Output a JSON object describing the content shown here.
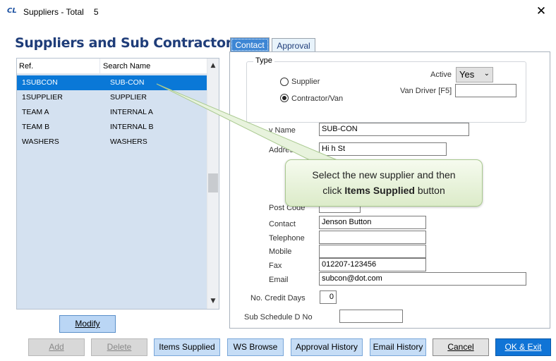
{
  "window": {
    "icon_text": "CL",
    "title": "Suppliers - Total",
    "total": "5",
    "close": "✕"
  },
  "heading": "Suppliers and Sub Contractors",
  "list": {
    "columns": [
      "Ref.",
      "Search Name"
    ],
    "rows": [
      {
        "ref": "1SUBCON",
        "name": "SUB-CON",
        "selected": true
      },
      {
        "ref": "1SUPPLIER",
        "name": "SUPPLIER",
        "selected": false
      },
      {
        "ref": "TEAM A",
        "name": "INTERNAL A",
        "selected": false
      },
      {
        "ref": "TEAM B",
        "name": "INTERNAL B",
        "selected": false
      },
      {
        "ref": "WASHERS",
        "name": "WASHERS",
        "selected": false
      }
    ],
    "scroll_up": "▲",
    "scroll_down": "▼"
  },
  "tabs": {
    "contact": "Contact",
    "approval": "Approval"
  },
  "form": {
    "type_legend": "Type",
    "supplier_label": "Supplier",
    "contractor_label": "Contractor/Van",
    "selected_type": "Contractor/Van",
    "active_label": "Active",
    "active_value": "Yes",
    "active_arrow": "⌄",
    "van_driver_label": "Van Driver [F5]",
    "van_driver_value": "",
    "company_name_label": "y Name",
    "company_name_value": "SUB-CON",
    "address_label": "Address",
    "address_line1": "Hi h St",
    "postcode_label": "Post Code",
    "contact_label": "Contact",
    "contact_value": "Jenson Button",
    "telephone_label": "Telephone",
    "telephone_value": "",
    "mobile_label": "Mobile",
    "mobile_value": "",
    "fax_label": "Fax",
    "fax_value": "012207-123456",
    "email_label": "Email",
    "email_value": "subcon@dot.com",
    "credit_days_label": "No. Credit Days",
    "credit_days_value": "0",
    "sub_schedule_label": "Sub Schedule D No",
    "sub_schedule_value": ""
  },
  "callout": {
    "line1": "Select the new supplier and then",
    "line2_prefix": "click",
    "line2_bold": "Items Supplied",
    "line2_suffix": "button"
  },
  "buttons": {
    "modify": "Modify",
    "add": "Add",
    "delete": "Delete",
    "items_supplied": "Items Supplied",
    "ws_browse": "WS Browse",
    "approval_history": "Approval History",
    "email_history": "Email History",
    "cancel": "Cancel",
    "ok_exit": "OK & Exit"
  },
  "colors": {
    "heading": "#1f3d79",
    "selection": "#0a78d7",
    "list_background": "#d4e1f0",
    "primary_button": "#1074d6",
    "callout": "#dcebc9"
  }
}
